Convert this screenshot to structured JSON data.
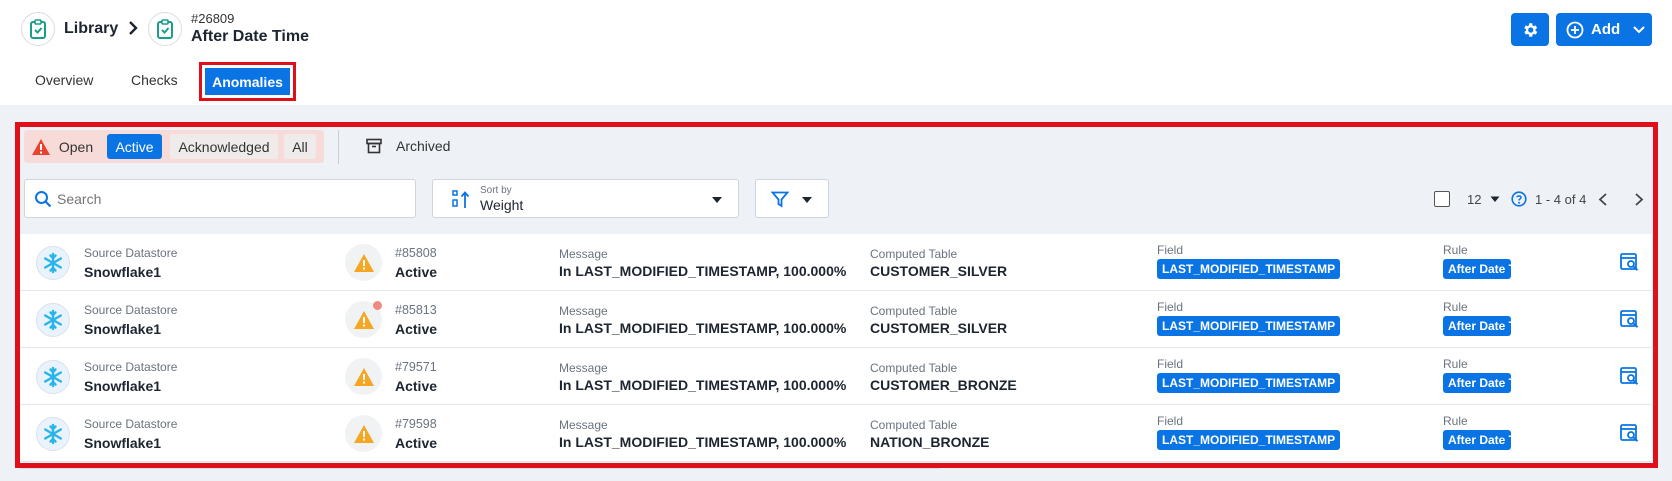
{
  "breadcrumb": {
    "library_label": "Library",
    "check_id": "#26809",
    "check_title": "After Date Time"
  },
  "header": {
    "add_label": "Add"
  },
  "tabs": [
    {
      "label": "Overview"
    },
    {
      "label": "Checks"
    },
    {
      "label": "Anomalies"
    }
  ],
  "status_filter": {
    "open_label": "Open",
    "active_label": "Active",
    "acknowledged_label": "Acknowledged",
    "all_label": "All",
    "archived_label": "Archived"
  },
  "search": {
    "placeholder": "Search"
  },
  "sort": {
    "caption": "Sort by",
    "value": "Weight"
  },
  "pager": {
    "page_size": "12",
    "range": "1 - 4 of 4"
  },
  "labels": {
    "source": "Source Datastore",
    "message": "Message",
    "table": "Computed Table",
    "field": "Field",
    "rule": "Rule"
  },
  "rows": [
    {
      "source": "Snowflake1",
      "id": "#85808",
      "status": "Active",
      "message": "In LAST_MODIFIED_TIMESTAMP, 100.000% of...",
      "table": "CUSTOMER_SILVER",
      "field": "LAST_MODIFIED_TIMESTAMP",
      "rule": "After Date Time",
      "has_dot": false
    },
    {
      "source": "Snowflake1",
      "id": "#85813",
      "status": "Active",
      "message": "In LAST_MODIFIED_TIMESTAMP, 100.000% of...",
      "table": "CUSTOMER_SILVER",
      "field": "LAST_MODIFIED_TIMESTAMP",
      "rule": "After Date Time",
      "has_dot": true
    },
    {
      "source": "Snowflake1",
      "id": "#79571",
      "status": "Active",
      "message": "In LAST_MODIFIED_TIMESTAMP, 100.000% of...",
      "table": "CUSTOMER_BRONZE",
      "field": "LAST_MODIFIED_TIMESTAMP",
      "rule": "After Date Time",
      "has_dot": false
    },
    {
      "source": "Snowflake1",
      "id": "#79598",
      "status": "Active",
      "message": "In LAST_MODIFIED_TIMESTAMP, 100.000% of...",
      "table": "NATION_BRONZE",
      "field": "LAST_MODIFIED_TIMESTAMP",
      "rule": "After Date Time",
      "has_dot": false
    }
  ],
  "colors": {
    "accent": "#0b74e5",
    "highlight": "#e0101b",
    "warning": "#f5a623",
    "alert": "#e8432e",
    "snowflake": "#29b5e8"
  }
}
